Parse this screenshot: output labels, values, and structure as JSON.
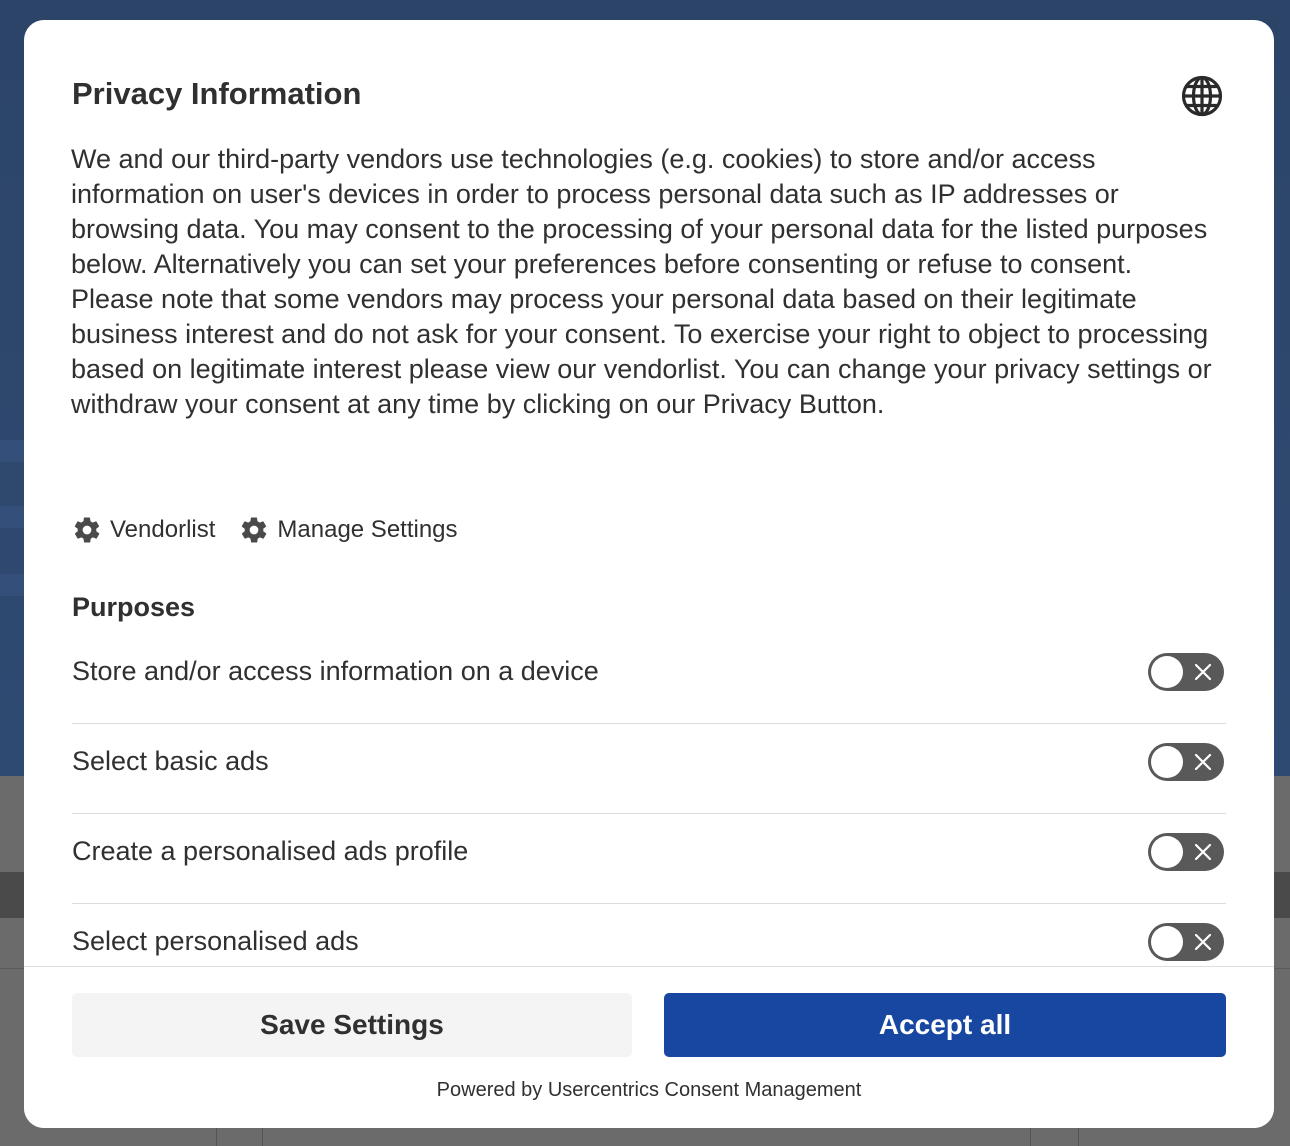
{
  "modal": {
    "title": "Privacy Information",
    "language_icon": "globe-icon",
    "description": "We and our third-party vendors use technologies (e.g. cookies) to store and/or access information on user's devices in order to process personal data such as IP addresses or browsing data. You may consent to the processing of your personal data for the listed purposes below. Alternatively you can set your preferences before consenting or refuse to consent. Please note that some vendors may process your personal data based on their legitimate business interest and do not ask for your consent. To exercise your right to object to processing based on legitimate interest please view our vendorlist. You can change your privacy settings or withdraw your consent at any time by clicking on our Privacy Button.",
    "links": [
      {
        "label": "Vendorlist",
        "icon": "gear-icon"
      },
      {
        "label": "Manage Settings",
        "icon": "gear-icon"
      }
    ],
    "purposes_title": "Purposes",
    "purposes": [
      {
        "label": "Store and/or access information on a device",
        "enabled": false
      },
      {
        "label": "Select basic ads",
        "enabled": false
      },
      {
        "label": "Create a personalised ads profile",
        "enabled": false
      },
      {
        "label": "Select personalised ads",
        "enabled": false
      }
    ]
  },
  "footer": {
    "save_label": "Save Settings",
    "accept_label": "Accept all",
    "powered_by": "Powered by Usercentrics Consent Management"
  },
  "colors": {
    "accent": "#1747a0",
    "toggle_off": "#595959",
    "text": "#303030"
  }
}
